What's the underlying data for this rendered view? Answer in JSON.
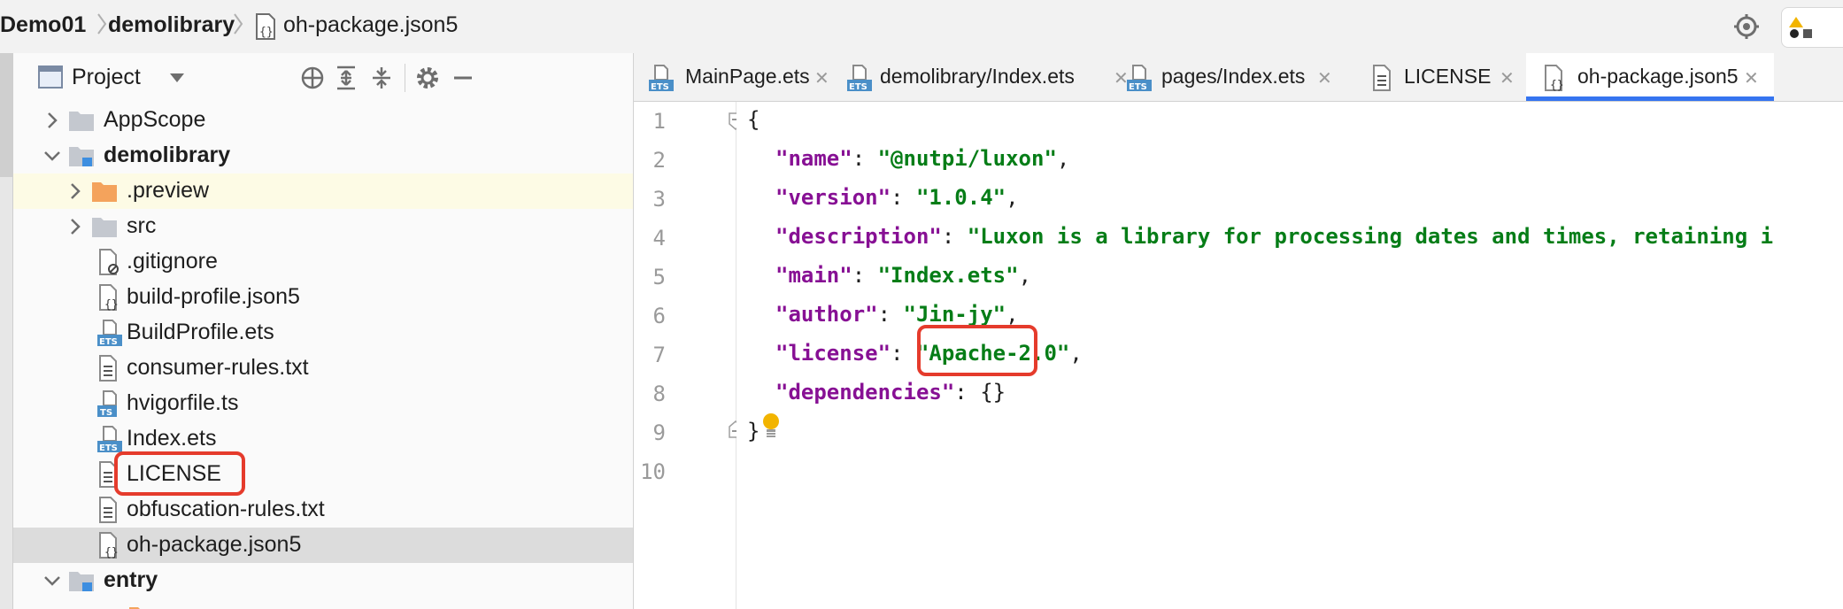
{
  "breadcrumb": [
    "Demo01",
    "demolibrary",
    "oh-package.json5"
  ],
  "project_panel": {
    "title": "Project",
    "tree": [
      {
        "label": "AppScope",
        "icon": "folder-icon",
        "expanded": false,
        "bold": false
      },
      {
        "label": "demolibrary",
        "icon": "module-folder-icon",
        "expanded": true,
        "bold": true
      },
      {
        "label": ".preview",
        "icon": "orange-folder-icon",
        "expanded": false,
        "bold": false
      },
      {
        "label": "src",
        "icon": "folder-icon",
        "expanded": false,
        "bold": false
      },
      {
        "label": ".gitignore",
        "icon": "ignore-file-icon",
        "bold": false
      },
      {
        "label": "build-profile.json5",
        "icon": "json-file-icon",
        "bold": false
      },
      {
        "label": "BuildProfile.ets",
        "icon": "ets-file-icon",
        "bold": false
      },
      {
        "label": "consumer-rules.txt",
        "icon": "text-file-icon",
        "bold": false
      },
      {
        "label": "hvigorfile.ts",
        "icon": "ts-file-icon",
        "bold": false
      },
      {
        "label": "Index.ets",
        "icon": "ets-file-icon",
        "bold": false
      },
      {
        "label": "LICENSE",
        "icon": "text-file-icon",
        "bold": false
      },
      {
        "label": "obfuscation-rules.txt",
        "icon": "text-file-icon",
        "bold": false
      },
      {
        "label": "oh-package.json5",
        "icon": "json-file-icon",
        "bold": false,
        "selected": true
      },
      {
        "label": "entry",
        "icon": "module-folder-icon",
        "expanded": true,
        "bold": true
      }
    ]
  },
  "editor": {
    "tabs": [
      {
        "label": "MainPage.ets",
        "icon": "ets-file-icon",
        "active": false
      },
      {
        "label": "demolibrary/Index.ets",
        "icon": "ets-file-icon",
        "active": false
      },
      {
        "label": "pages/Index.ets",
        "icon": "ets-file-icon",
        "active": false
      },
      {
        "label": "LICENSE",
        "icon": "text-file-icon",
        "active": false
      },
      {
        "label": "oh-package.json5",
        "icon": "json-file-icon",
        "active": true
      }
    ],
    "line_numbers": [
      "1",
      "2",
      "3",
      "4",
      "5",
      "6",
      "7",
      "8",
      "9",
      "10"
    ],
    "code": {
      "l1_open": "{",
      "name_key": "\"name\"",
      "name_val": "\"@nutpi/luxon\"",
      "version_key": "\"version\"",
      "version_val": "\"1.0.4\"",
      "description_key": "\"description\"",
      "description_val": "\"Luxon is a library for processing dates and times, retaining i",
      "main_key": "\"main\"",
      "main_val": "\"Index.ets\"",
      "author_key": "\"author\"",
      "author_val": "\"Jin-jy\"",
      "license_key": "\"license\"",
      "license_val": "\"Apache-2.0\"",
      "dependencies_key": "\"dependencies\"",
      "dependencies_val": "{}",
      "l9_close": "}"
    }
  },
  "colors": {
    "accent": "#3574f0",
    "annotation": "#e53b2c",
    "json_key": "#871094",
    "json_string": "#067d17"
  }
}
